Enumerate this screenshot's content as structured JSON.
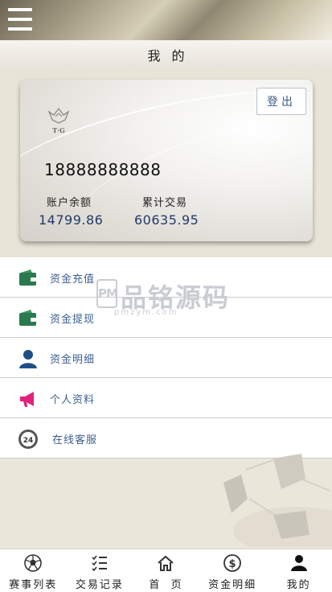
{
  "header": {
    "title": "我的"
  },
  "card": {
    "logout_label": "登出",
    "logo_text": "T·G",
    "phone": "18888888888",
    "balance_label": "账户余额",
    "balance_value": "14799.86",
    "total_label": "累计交易",
    "total_value": "60635.95"
  },
  "menu": [
    {
      "label": "资金充值",
      "icon": "wallet-icon"
    },
    {
      "label": "资金提现",
      "icon": "wallet-icon"
    },
    {
      "label": "资金明细",
      "icon": "user-icon"
    },
    {
      "label": "个人资料",
      "icon": "megaphone-icon"
    },
    {
      "label": "在线客服",
      "icon": "24h-service-icon"
    }
  ],
  "watermark": {
    "badge": "PM",
    "text": "品铭源码",
    "sub": "pmzym.com"
  },
  "tabbar": [
    {
      "label": "赛事列表",
      "icon": "soccer-ball-icon"
    },
    {
      "label": "交易记录",
      "icon": "checklist-icon"
    },
    {
      "label": "首  页",
      "icon": "home-icon"
    },
    {
      "label": "资金明细",
      "icon": "dollar-icon"
    },
    {
      "label": "我的",
      "icon": "person-icon"
    }
  ],
  "colors": {
    "accent_blue": "#3d5f8f",
    "wallet_green": "#2a7a4e",
    "megaphone_pink": "#e2227a"
  }
}
